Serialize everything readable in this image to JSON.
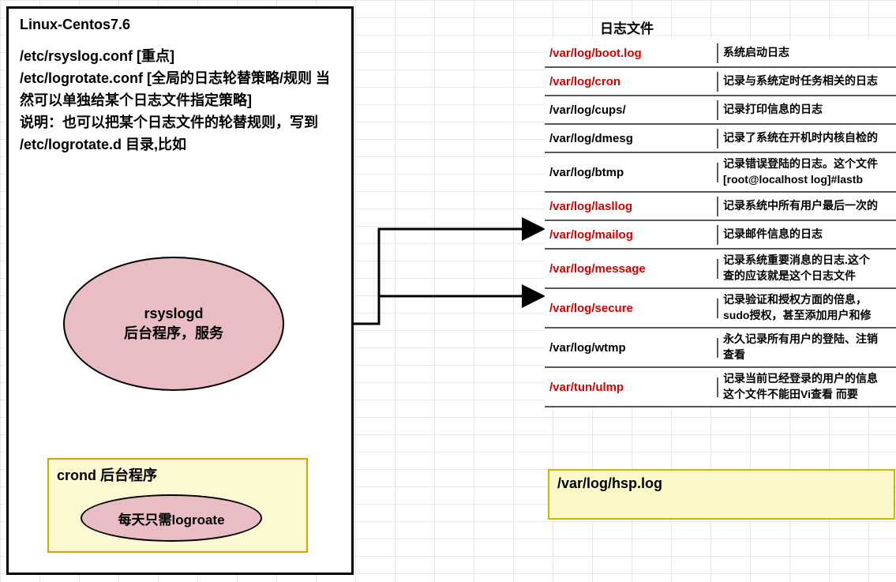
{
  "main": {
    "title": "Linux-Centos7.6",
    "line1": "/etc/rsyslog.conf [重点]",
    "line2": "/etc/logrotate.conf [全局的日志轮替策略/规则   当然可以单独给某个日志文件指定策略]",
    "line3": "说明：也可以把某个日志文件的轮替规则，写到 /etc/logrotate.d 目录,比如"
  },
  "rsyslog": {
    "l1": "rsyslogd",
    "l2": "后台程序，服务"
  },
  "crond": {
    "title": "crond 后台程序",
    "ellipse": "每天只需logroate"
  },
  "table": {
    "header": "日志文件",
    "rows": [
      {
        "file": "/var/log/boot.log",
        "desc": "系统启动日志",
        "red": true,
        "tall": false
      },
      {
        "file": "/var/log/cron",
        "desc": "记录与系统定时任务相关的日志",
        "red": true,
        "tall": false
      },
      {
        "file": "/var/log/cups/",
        "desc": "记录打印信息的日志",
        "red": false,
        "tall": false
      },
      {
        "file": "/var/log/dmesg",
        "desc": "记录了系统在开机时内核自检的",
        "red": false,
        "tall": false
      },
      {
        "file": "/var/log/btmp",
        "desc": "记录错误登陆的日志。这个文件\n[root@localhost log]#lastb",
        "red": false,
        "tall": true
      },
      {
        "file": "/var/log/lasllog",
        "desc": "记录系统中所有用户最后一次的",
        "red": true,
        "tall": false
      },
      {
        "file": "/var/Iog/mailog",
        "desc": "记录邮件信息的日志",
        "red": true,
        "tall": false
      },
      {
        "file": "/var/log/message",
        "desc": "记录系统重要消息的日志.这个\n查的应该就是这个日志文件",
        "red": true,
        "tall": true
      },
      {
        "file": "/var/log/secure",
        "desc": "记录验证和授权方面的倍息，\nsudo授权，甚至添加用户和修",
        "red": true,
        "tall": true
      },
      {
        "file": "/var/log/wtmp",
        "desc": "永久记录所有用户的登陆、注销\n查看",
        "red": false,
        "tall": true
      },
      {
        "file": "/var/tun/ulmp",
        "desc": "记录当前已经登录的用户的信息\n这个文件不能田Vi查看  而要",
        "red": true,
        "tall": true
      }
    ]
  },
  "hsp": {
    "text": "/var/log/hsp.log"
  },
  "chart_data": {
    "type": "diagram",
    "title": "Linux Centos7.6 rsyslogd log management diagram",
    "nodes": [
      {
        "id": "main",
        "label": "Linux-Centos7.6 config block"
      },
      {
        "id": "rsyslogd",
        "label": "rsyslogd 后台程序，服务"
      },
      {
        "id": "crond",
        "label": "crond 后台程序 / 每天只需logroate"
      },
      {
        "id": "logfiles",
        "label": "日志文件 table"
      },
      {
        "id": "hsplog",
        "label": "/var/log/hsp.log"
      }
    ],
    "edges": [
      {
        "from": "crond",
        "to": "main-text",
        "style": "up-arrow"
      },
      {
        "from": "rsyslogd",
        "to": "/var/log/lasllog row"
      },
      {
        "from": "rsyslogd",
        "to": "/var/log/message row"
      }
    ]
  }
}
